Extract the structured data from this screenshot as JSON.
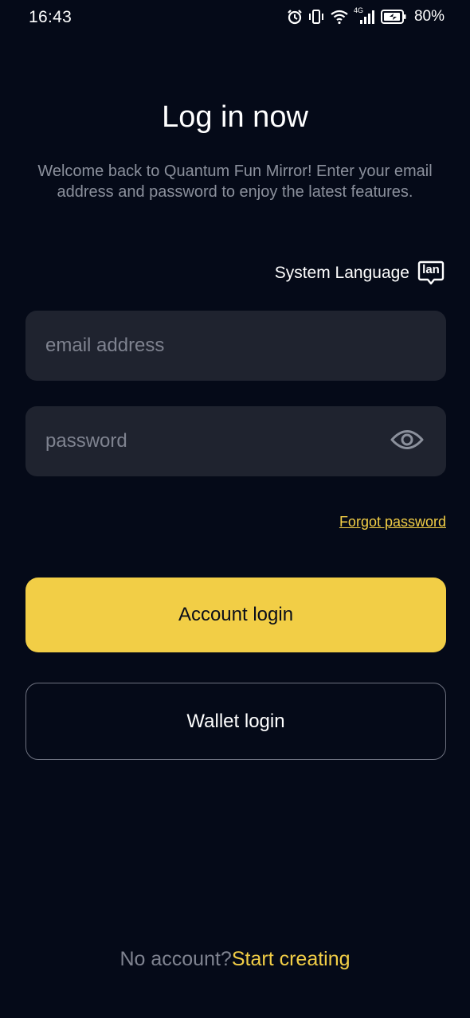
{
  "status_bar": {
    "time": "16:43",
    "network_label": "4G",
    "battery": "80%",
    "icons": [
      "alarm-icon",
      "vibrate-icon",
      "wifi-icon",
      "signal-icon",
      "battery-icon"
    ]
  },
  "header": {
    "title": "Log in now",
    "subtitle": "Welcome back to Quantum Fun Mirror! Enter your email address and password to enjoy the latest features."
  },
  "language": {
    "label": "System Language",
    "icon_text": "lan"
  },
  "form": {
    "email": {
      "value": "",
      "placeholder": "email address"
    },
    "password": {
      "value": "",
      "placeholder": "password"
    },
    "forgot_label": "Forgot password"
  },
  "actions": {
    "account_login_label": "Account login",
    "wallet_login_label": "Wallet login"
  },
  "footer": {
    "prompt": "No account?",
    "link": "Start creating"
  },
  "colors": {
    "background": "#050A18",
    "field": "#1F232F",
    "accent": "#F2CE46",
    "muted_text": "#8B909C"
  }
}
